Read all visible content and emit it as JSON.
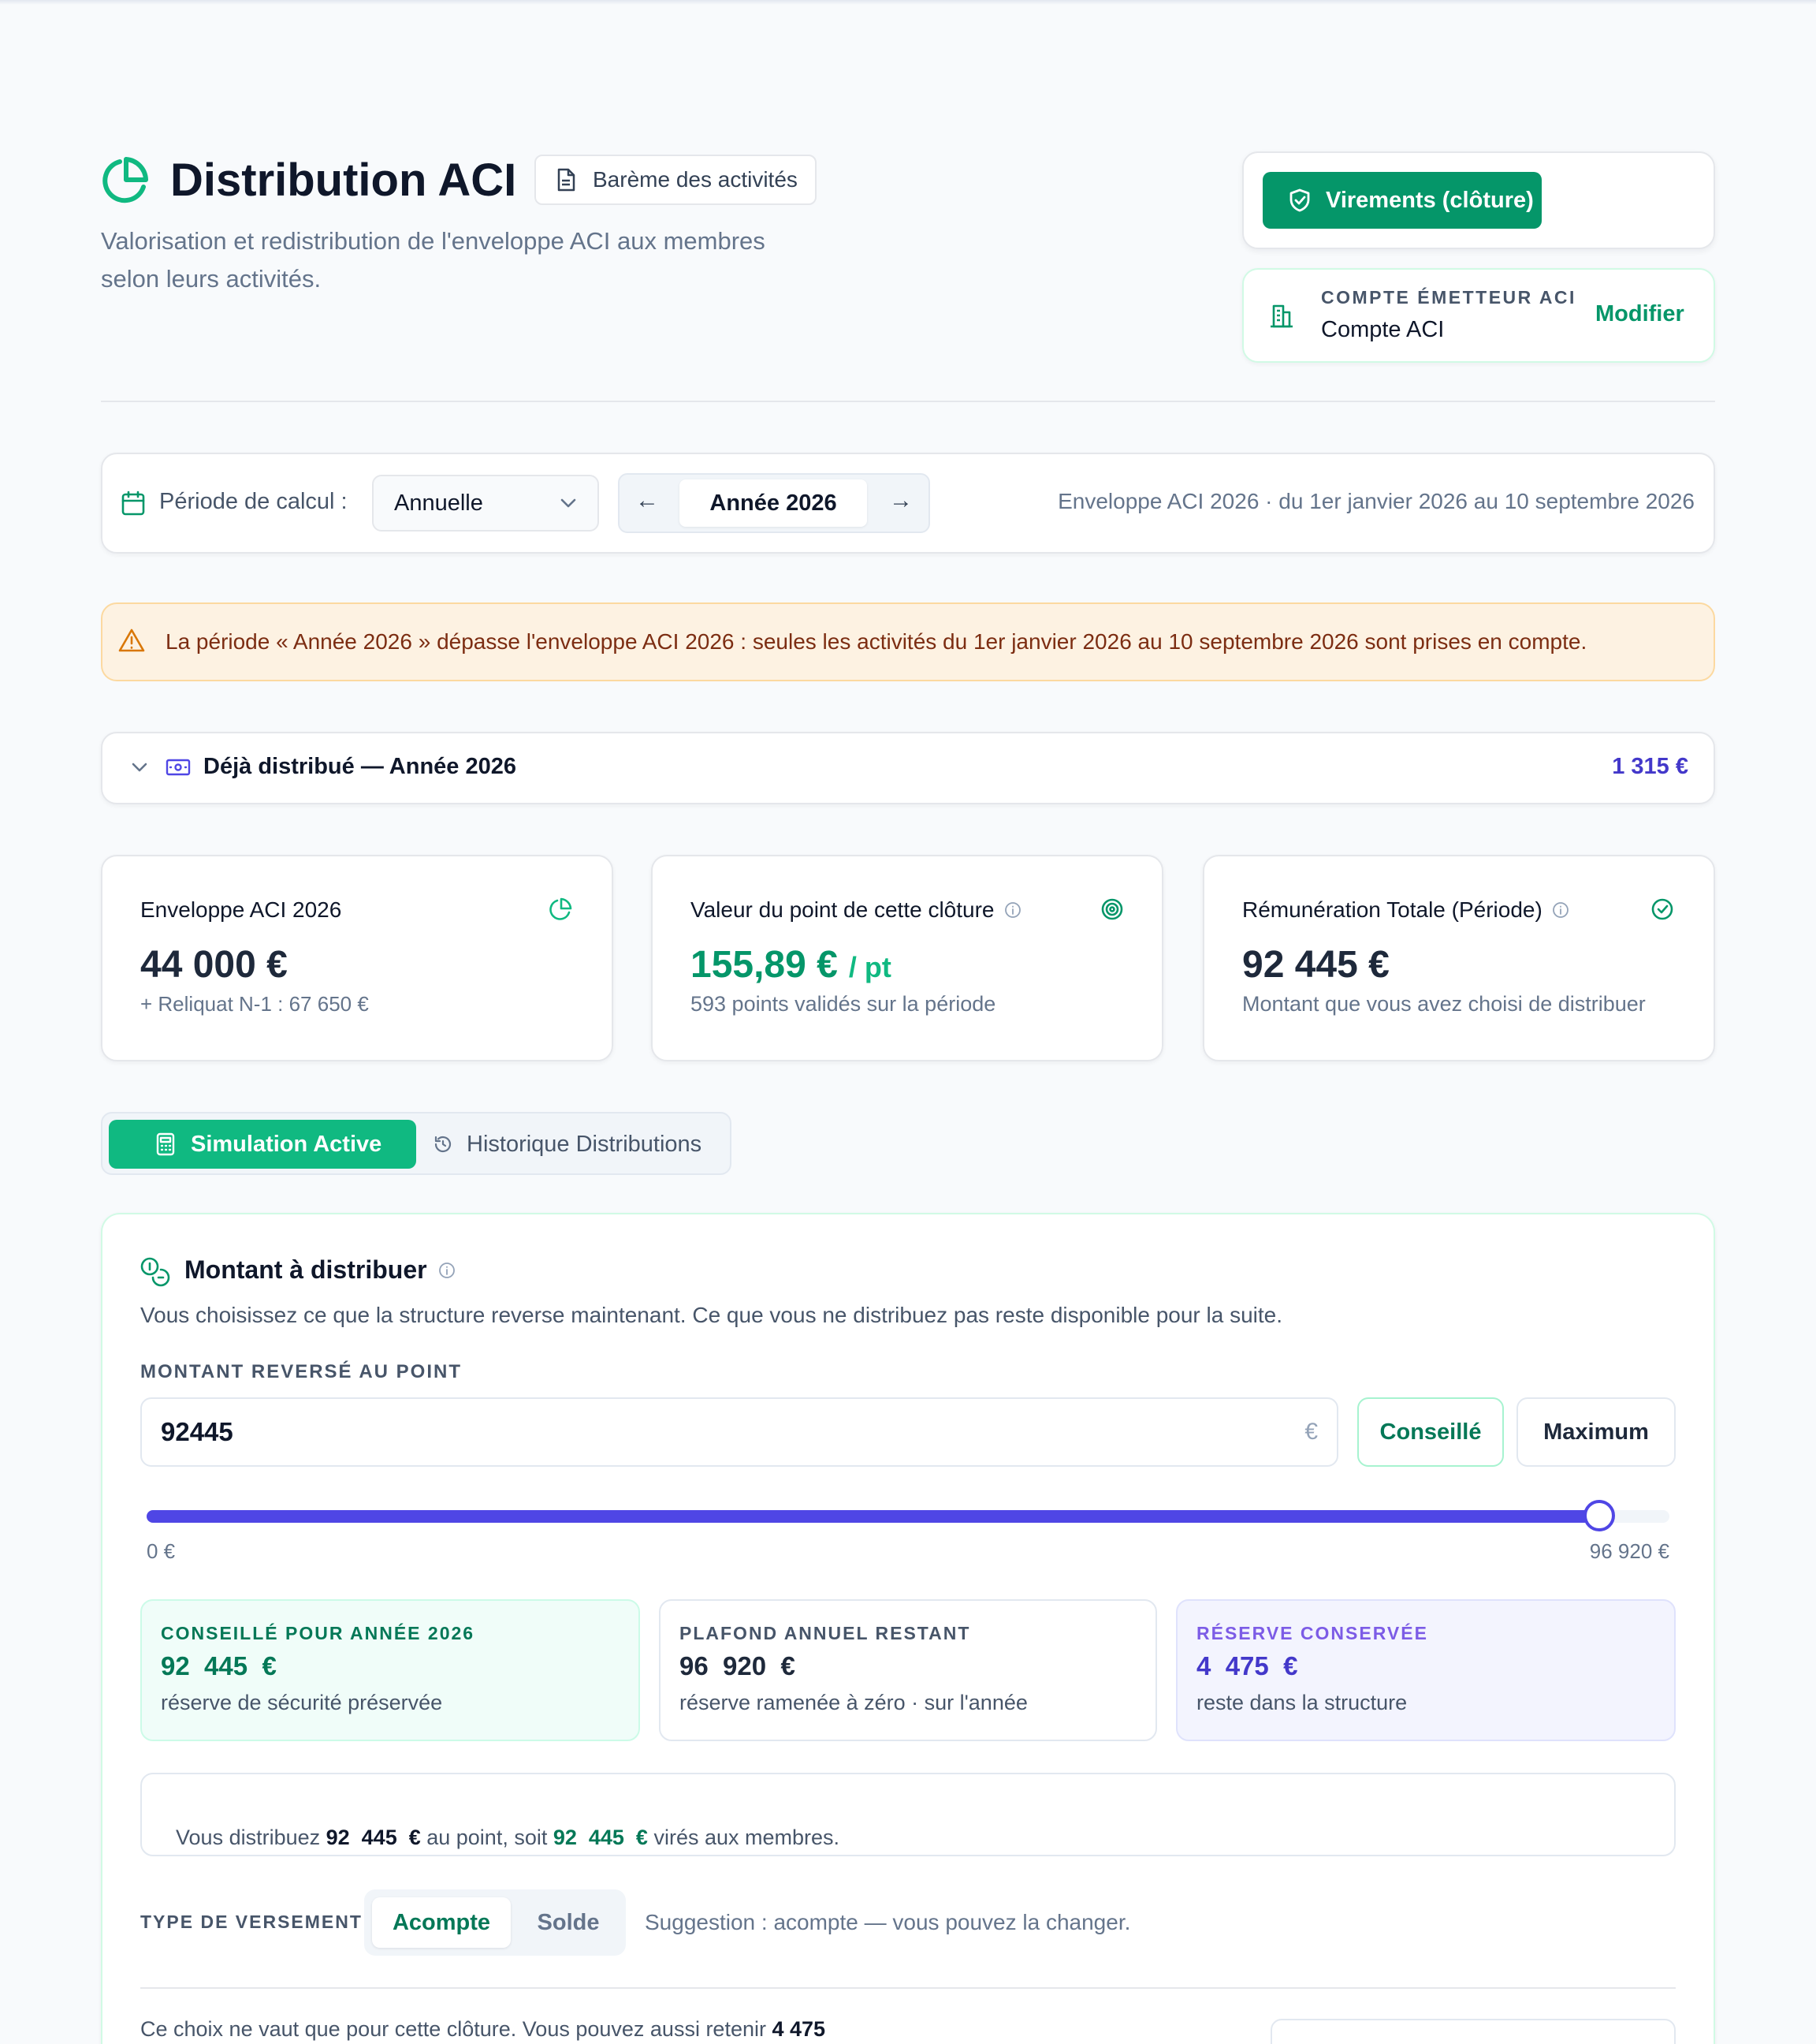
{
  "header": {
    "title": "Distribution ACI",
    "bareme_label": "Barème des activités",
    "subtitle_line1": "Valorisation et redistribution de l'enveloppe ACI aux membres",
    "subtitle_line2": "selon leurs activités."
  },
  "virements": {
    "label": "Virements (clôture)"
  },
  "compte": {
    "heading": "COMPTE ÉMETTEUR ACI",
    "name": "Compte ACI",
    "modify": "Modifier"
  },
  "periode": {
    "label": "Période de calcul :",
    "select_value": "Annuelle",
    "prev": "←",
    "year": "Année 2026",
    "next": "→",
    "info": "Enveloppe ACI 2026 · du 1er janvier 2026 au 10 septembre 2026"
  },
  "warning": {
    "text": "La période « Année 2026 » dépasse l'enveloppe ACI 2026 : seules les activités du 1er janvier 2026 au 10 septembre 2026 sont prises en compte."
  },
  "deja": {
    "label": "Déjà distribué — Année 2026",
    "amount": "1 315 €"
  },
  "stats": [
    {
      "title": "Enveloppe ACI 2026",
      "value": "44 000 €",
      "sub": "+ Reliquat N-1 : 67 650 €"
    },
    {
      "title": "Valeur du point de cette clôture",
      "value": "155,89 €",
      "unit": "/ pt",
      "sub": "593 points validés sur la période"
    },
    {
      "title": "Rémunération Totale (Période)",
      "value": "92 445 €",
      "sub": "Montant que vous avez choisi de distribuer"
    }
  ],
  "tabs": {
    "active": "Simulation Active",
    "history": "Historique Distributions"
  },
  "montant": {
    "title": "Montant à distribuer",
    "desc": "Vous choisissez ce que la structure reverse maintenant. Ce que vous ne distribuez pas reste disponible pour la suite.",
    "field_label": "MONTANT REVERSÉ AU POINT",
    "input_value": "92445",
    "currency": "€",
    "btn_conseille": "Conseillé",
    "btn_maximum": "Maximum",
    "slider_fraction": 0.9538,
    "slider_min": "0 €",
    "slider_max": "96 920 €",
    "boxes": [
      {
        "label": "CONSEILLÉ POUR ANNÉE 2026",
        "value": "92  445  €",
        "sub": "réserve de sécurité préservée"
      },
      {
        "label": "PLAFOND ANNUEL RESTANT",
        "value": "96  920  €",
        "sub": "réserve ramenée à zéro · sur l'année"
      },
      {
        "label": "RÉSERVE CONSERVÉE",
        "value": "4  475  €",
        "sub": "reste dans la structure"
      }
    ],
    "summary": {
      "pre": "Vous distribuez ",
      "amount1": "92  445  €",
      "mid": " au point, soit ",
      "amount2": "92  445  €",
      "post": " virés aux membres."
    },
    "versement_label": "TYPE DE VERSEMENT",
    "seg_acompte": "Acompte",
    "seg_solde": "Solde",
    "suggestion": "Suggestion : acompte — vous pouvez la changer.",
    "footer_text": "Ce choix ne vaut que pour cette clôture. Vous pouvez aussi retenir ",
    "footer_amount": "4 475"
  },
  "colors": {
    "green": "#059669",
    "green_btn": "#10b981",
    "indigo": "#4f46e5",
    "warning_bg": "#fdf2e2",
    "warning_text": "#7c2d12"
  }
}
